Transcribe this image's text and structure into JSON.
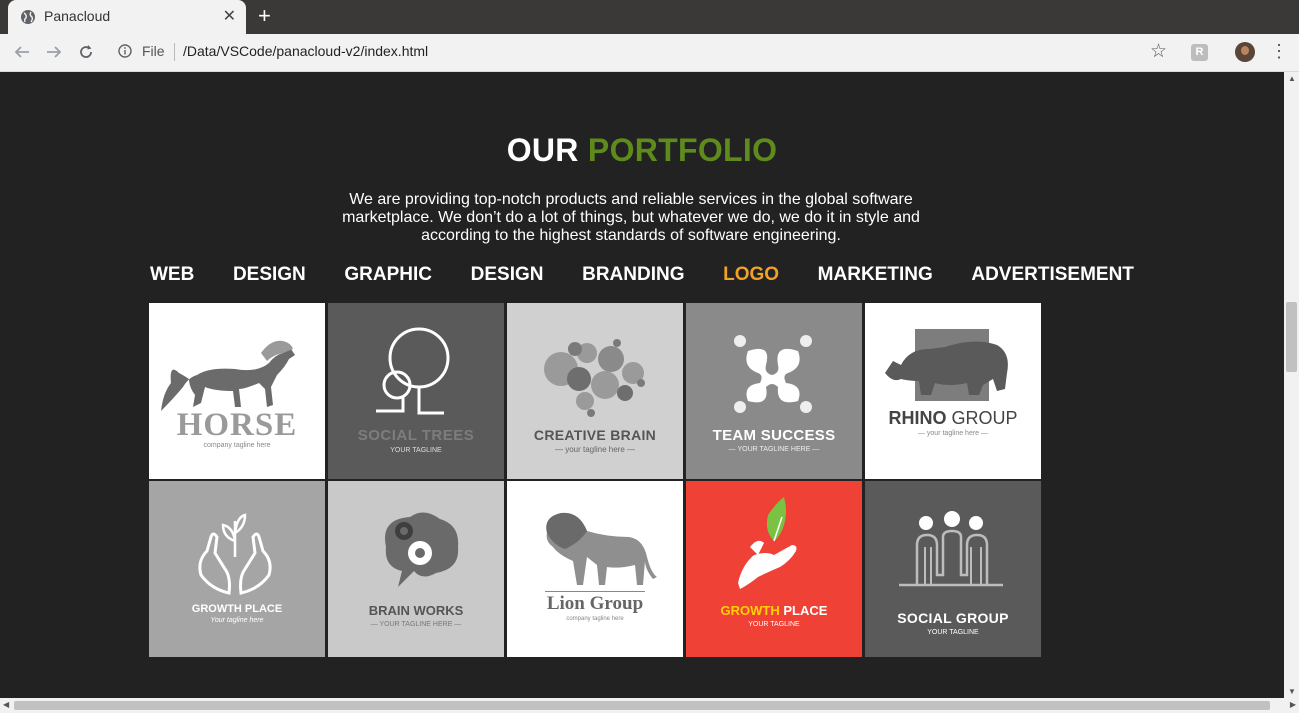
{
  "browser": {
    "tab_title": "Panacloud",
    "url_scheme": "File",
    "url": "/Data/VSCode/panacloud-v2/index.html"
  },
  "header": {
    "title_white": "OUR",
    "title_green": "PORTFOLIO",
    "description": "We are providing top-notch products and reliable services in the global software marketplace. We don’t do a lot of things, but whatever we do, we do it in style and according to the highest standards of software engineering."
  },
  "filters": [
    {
      "label": "WEB",
      "active": false
    },
    {
      "label": "DESIGN",
      "active": false
    },
    {
      "label": "GRAPHIC",
      "active": false
    },
    {
      "label": "DESIGN",
      "active": false
    },
    {
      "label": "BRANDING",
      "active": false
    },
    {
      "label": "LOGO",
      "active": true
    },
    {
      "label": "MARKETING",
      "active": false
    },
    {
      "label": "ADVERTISEMENT",
      "active": false
    }
  ],
  "colors": {
    "accent_green": "#5f8a1c",
    "active_orange": "#f1a028",
    "background": "#222222"
  },
  "portfolio": [
    {
      "name": "HORSE",
      "tagline": "company tagline here",
      "bg": "#ffffff"
    },
    {
      "name": "SOCIAL TREES",
      "tagline": "YOUR TAGLINE",
      "bg": "#5a5a5a"
    },
    {
      "name": "CREATIVE BRAIN",
      "tagline": "— your tagline here —",
      "bg": "#d0d0d0"
    },
    {
      "name": "TEAM SUCCESS",
      "tagline": "— YOUR TAGLINE HERE —",
      "bg": "#8a8a8a"
    },
    {
      "name_a": "RHINO",
      "name_b": "GROUP",
      "tagline": "— your tagline here —",
      "bg": "#ffffff"
    },
    {
      "name": "GROWTH PLACE",
      "tagline": "Your tagline here",
      "bg": "#a5a5a5"
    },
    {
      "name": "BRAIN WORKS",
      "tagline": "— YOUR TAGLINE HERE —",
      "bg": "#c9c9c9"
    },
    {
      "name": "Lion Group",
      "tagline": "company tagline here",
      "bg": "#ffffff"
    },
    {
      "name_a": "GROWTH",
      "name_b": "PLACE",
      "tagline": "YOUR TAGLINE",
      "bg": "#ef4136"
    },
    {
      "name": "SOCIAL GROUP",
      "tagline": "YOUR TAGLINE",
      "bg": "#5a5a5a"
    }
  ]
}
